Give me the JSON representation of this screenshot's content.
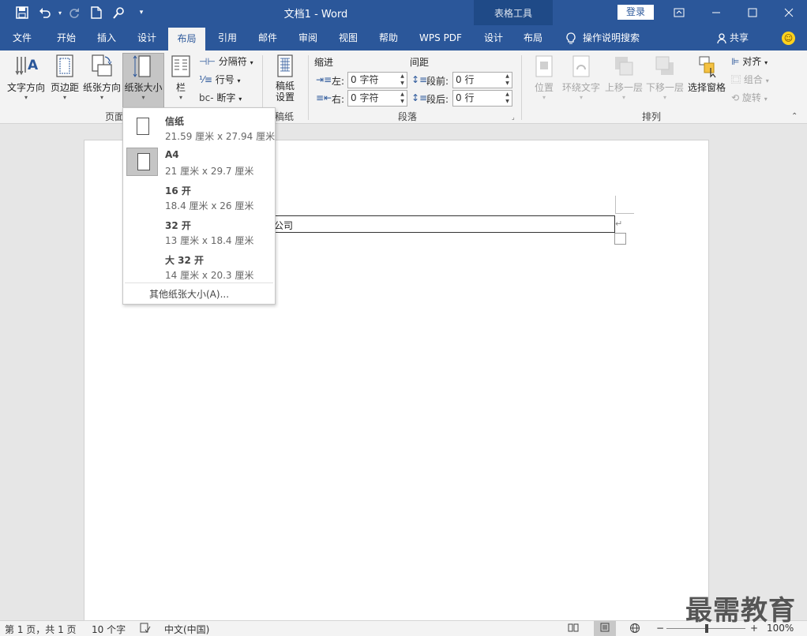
{
  "title_bar": {
    "document_title": "文档1  -  Word",
    "context_group": "表格工具",
    "login_label": "登录",
    "quick_access_icons": [
      "save-icon",
      "undo-icon",
      "redo-icon",
      "new-document-icon",
      "touch-mode-icon",
      "customize-icon"
    ]
  },
  "tabs": [
    {
      "label": "文件"
    },
    {
      "label": "开始"
    },
    {
      "label": "插入"
    },
    {
      "label": "设计"
    },
    {
      "label": "布局"
    },
    {
      "label": "引用"
    },
    {
      "label": "邮件"
    },
    {
      "label": "审阅"
    },
    {
      "label": "视图"
    },
    {
      "label": "帮助"
    },
    {
      "label": "WPS PDF"
    },
    {
      "label": "设计"
    },
    {
      "label": "布局"
    }
  ],
  "tell_me": "操作说明搜索",
  "share": "共享",
  "ribbon": {
    "page_setup": {
      "text_direction": "文字方向",
      "margins": "页边距",
      "orientation": "纸张方向",
      "size": "纸张大小",
      "columns": "栏",
      "breaks": "分隔符",
      "line_numbers": "行号",
      "hyphenation": "断字",
      "group_label": "页面"
    },
    "manuscript": {
      "settings_line1": "稿纸",
      "settings_line2": "设置",
      "group_label": "稿纸"
    },
    "paragraph": {
      "indent_label": "缩进",
      "spacing_label": "间距",
      "left_label": "左:",
      "right_label": "右:",
      "before_label": "段前:",
      "after_label": "段后:",
      "left_value": "0 字符",
      "right_value": "0 字符",
      "before_value": "0 行",
      "after_value": "0 行",
      "group_label": "段落"
    },
    "arrange": {
      "position": "位置",
      "wrap_text": "环绕文字",
      "bring_forward": "上移一层",
      "send_backward": "下移一层",
      "selection_pane": "选择窗格",
      "align": "对齐",
      "group": "组合",
      "rotate": "旋转",
      "group_label": "排列"
    }
  },
  "paper_sizes": [
    {
      "name": "信纸",
      "size": "21.59 厘米 x 27.94 厘米",
      "selected": false
    },
    {
      "name": "A4",
      "size": "21 厘米 x 29.7 厘米",
      "selected": true
    },
    {
      "name": "16 开",
      "size": "18.4 厘米 x 26 厘米",
      "selected": false
    },
    {
      "name": "32 开",
      "size": "13 厘米 x 18.4 厘米",
      "selected": false
    },
    {
      "name": "大 32 开",
      "size": "14 厘米 x 20.3 厘米",
      "selected": false
    }
  ],
  "more_sizes": "其他纸张大小(A)...",
  "document": {
    "cell_text": "公司",
    "cell_end_mark": "↵"
  },
  "status_bar": {
    "page": "第 1 页，共 1 页",
    "words": "10 个字",
    "language": "中文(中国)",
    "zoom": "100%",
    "zoom_level_percent": 100
  },
  "watermark": "最需教育",
  "colors": {
    "brand_blue": "#2b579a",
    "context_blue": "#1f4a87",
    "ribbon_bg": "#f3f3f3"
  }
}
